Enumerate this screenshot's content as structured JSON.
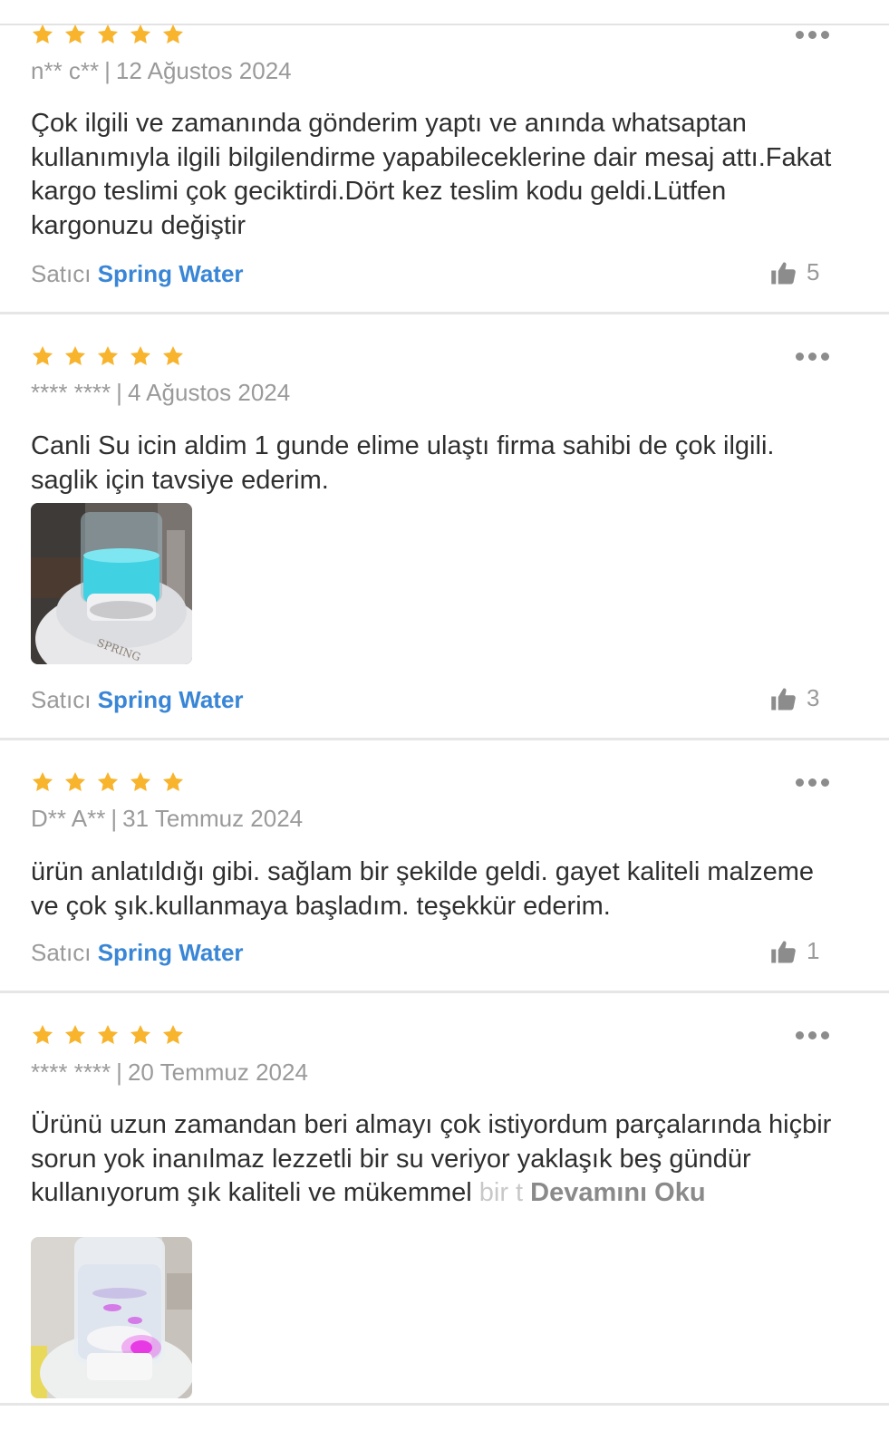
{
  "reviews": [
    {
      "rating": 5,
      "author": "n** c**",
      "date": "12 Ağustos 2024",
      "text": "Çok ilgili ve zamanında gönderim yaptı ve anında whatsaptan kullanımıyla ilgili bilgilendirme yapabileceklerine dair mesaj attı.Fakat kargo teslimi  çok geciktirdi.Dört kez teslim kodu geldi.Lütfen kargonuzu değiştir",
      "seller_label": "Satıcı",
      "seller_name": "Spring Water",
      "likes": "5"
    },
    {
      "rating": 5,
      "author": "**** ****",
      "date": "4 Ağustos 2024",
      "text": "Canli Su icin aldim 1 gunde elime ulaştı firma sahibi de çok ilgili. saglik için tavsiye ederim.",
      "seller_label": "Satıcı",
      "seller_name": "Spring Water",
      "likes": "3",
      "photo_logo": "SPRING"
    },
    {
      "rating": 5,
      "author": "D** A**",
      "date": "31 Temmuz 2024",
      "text": "ürün anlatıldığı gibi. sağlam bir şekilde geldi. gayet kaliteli malzeme ve çok şık.kullanmaya başladım. teşekkür ederim.",
      "seller_label": "Satıcı",
      "seller_name": "Spring Water",
      "likes": "1"
    },
    {
      "rating": 5,
      "author": "**** ****",
      "date": "20 Temmuz 2024",
      "text": "Ürünü uzun zamandan beri almayı çok istiyordum parçalarında hiçbir sorun yok inanılmaz lezzetli bir su veriyor yaklaşık beş gündür kullanıyorum şık kaliteli ve mükemmel",
      "text_fade": " bir t",
      "read_more": "Devamını Oku"
    }
  ],
  "separator": "|",
  "colors": {
    "star": "#f7b42c",
    "seller_link": "#3a86d6",
    "meta_text": "#9a9a9a",
    "divider": "#e6e6e6"
  },
  "icons": {
    "star": "star-icon",
    "more": "more-options-icon",
    "like": "thumbs-up-icon"
  }
}
